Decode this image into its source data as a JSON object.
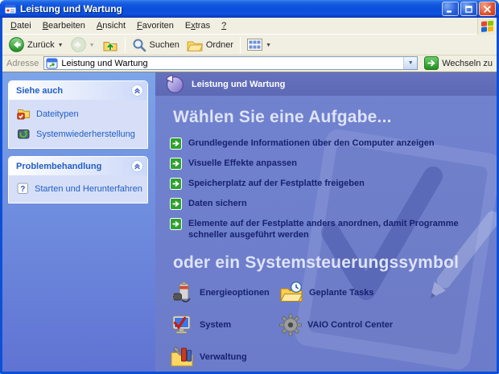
{
  "window": {
    "title": "Leistung und Wartung"
  },
  "menu": {
    "items": [
      {
        "label": "Datei"
      },
      {
        "label": "Bearbeiten"
      },
      {
        "label": "Ansicht"
      },
      {
        "label": "Favoriten"
      },
      {
        "label": "Extras"
      },
      {
        "label": "?"
      }
    ]
  },
  "toolbar": {
    "back_label": "Zurück",
    "search_label": "Suchen",
    "folders_label": "Ordner"
  },
  "address": {
    "label": "Adresse",
    "value": "Leistung und Wartung",
    "go_label": "Wechseln zu"
  },
  "sidebar": {
    "panels": [
      {
        "title": "Siehe auch",
        "items": [
          {
            "label": "Dateitypen",
            "icon": "file-types-icon"
          },
          {
            "label": "Systemwiederherstellung",
            "icon": "system-restore-icon"
          }
        ]
      },
      {
        "title": "Problembehandlung",
        "items": [
          {
            "label": "Starten und Herunterfahren",
            "icon": "help-icon"
          }
        ]
      }
    ]
  },
  "content": {
    "banner_title": "Leistung und Wartung",
    "tasks_heading": "Wählen Sie eine Aufgabe...",
    "tasks": [
      {
        "label": "Grundlegende Informationen über den Computer anzeigen"
      },
      {
        "label": "Visuelle Effekte anpassen"
      },
      {
        "label": "Speicherplatz auf der Festplatte freigeben"
      },
      {
        "label": "Daten sichern"
      },
      {
        "label": "Elemente auf der Festplatte anders anordnen, damit Programme schneller ausgeführt werden"
      }
    ],
    "controls_heading": "oder ein Systemsteuerungssymbol",
    "control_panel_items": [
      {
        "label": "Energieoptionen",
        "icon": "power-options-icon"
      },
      {
        "label": "Geplante Tasks",
        "icon": "scheduled-tasks-icon"
      },
      {
        "label": "System",
        "icon": "system-icon"
      },
      {
        "label": "VAIO Control Center",
        "icon": "gear-icon"
      },
      {
        "label": "Verwaltung",
        "icon": "admin-tools-icon"
      }
    ]
  },
  "colors": {
    "titlebar_blue": "#0C50D8",
    "chrome_beige": "#F1EFE2",
    "taskpane_top": "#7CA4E8",
    "taskpane_bottom": "#6073D3",
    "panel_body": "#D6DFF7",
    "link_blue": "#215DC6",
    "content_blue": "#6F7ECC",
    "banner_blue": "#6772BE",
    "heading_lavender": "#DEE3F8",
    "task_navy": "#16226E",
    "accent_green": "#2EA12E"
  }
}
